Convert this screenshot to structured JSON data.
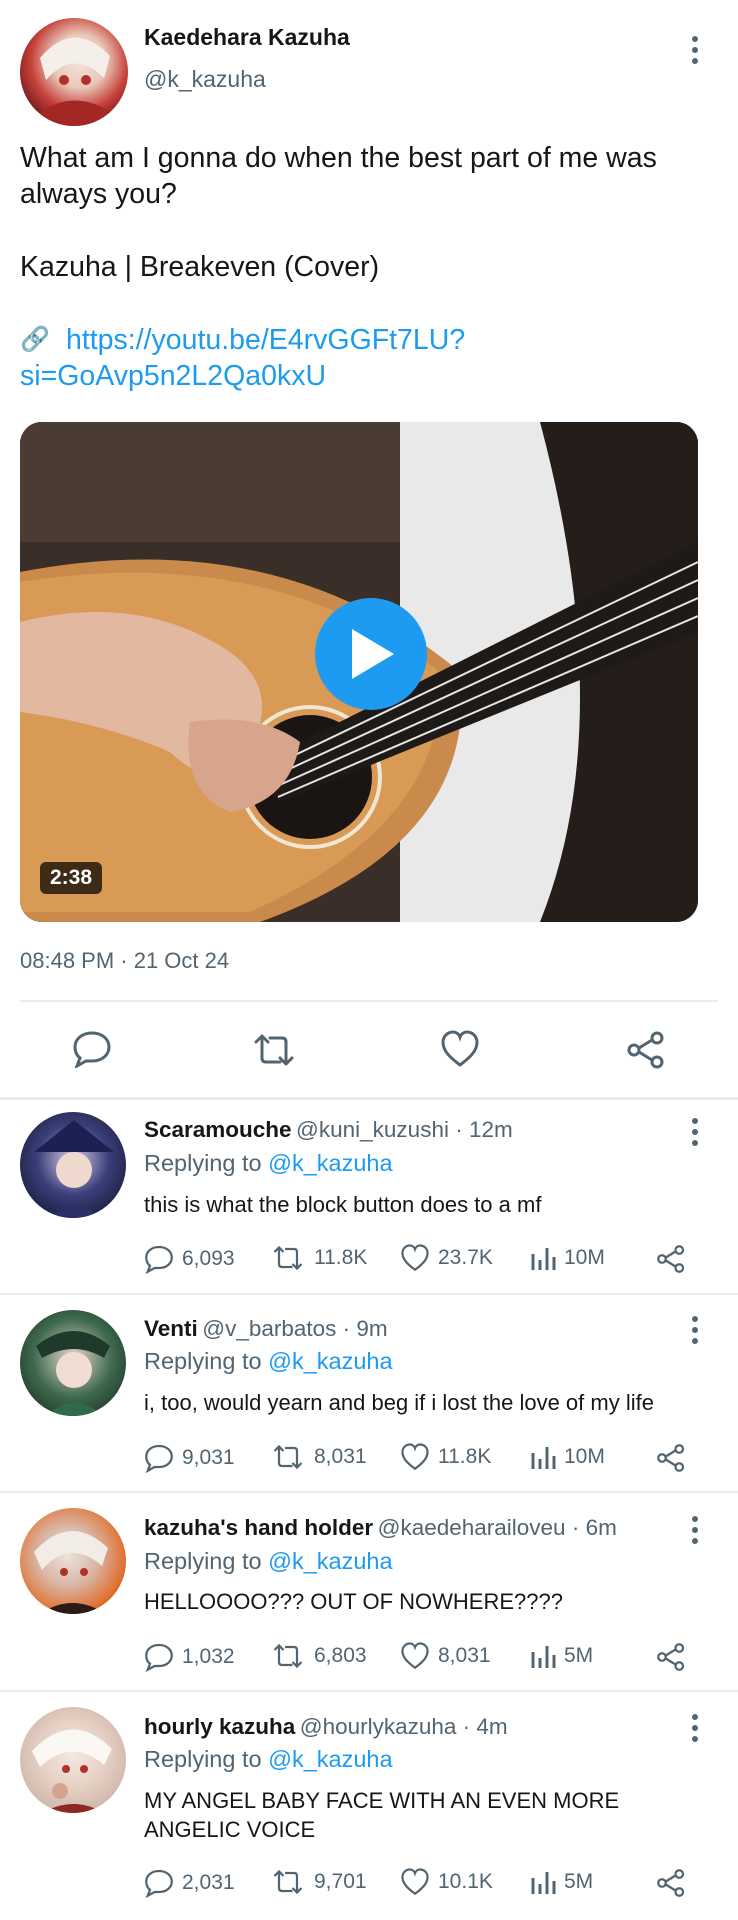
{
  "post": {
    "author_name": "Kaedehara Kazuha",
    "author_handle": "@k_kazuha",
    "text_line1": "What am I gonna do when the best part of me was",
    "text_line2": "always you?",
    "text_line3": "Kazuha | Breakeven (Cover)",
    "link_icon": "🔗",
    "link_line1": "https://youtu.be/E4rvGGFt7LU?",
    "link_line2": "si=GoAvp5n2L2Qa0kxU",
    "video_duration": "2:38",
    "timestamp": "08:48 PM · 21 Oct 24"
  },
  "replies": [
    {
      "name": "Scaramouche",
      "handle": "@kuni_kuzushi · 12m",
      "replying_label": "Replying to",
      "replying_to": "@k_kazuha",
      "text": "this is what the block button does to a mf",
      "text2": "",
      "comments": "6,093",
      "retweets": "11.8K",
      "likes": "23.7K",
      "views": "10M"
    },
    {
      "name": "Venti",
      "handle": "@v_barbatos · 9m",
      "replying_label": "Replying to",
      "replying_to": "@k_kazuha",
      "text": "i, too, would yearn and beg if i lost the love of my life",
      "text2": "",
      "comments": "9,031",
      "retweets": "8,031",
      "likes": "11.8K",
      "views": "10M"
    },
    {
      "name": "kazuha's hand holder",
      "handle": "@kaedeharailoveu · 6m",
      "replying_label": "Replying to",
      "replying_to": "@k_kazuha",
      "text": "HELLOOOO??? OUT OF NOWHERE????",
      "text2": "",
      "comments": "1,032",
      "retweets": "6,803",
      "likes": "8,031",
      "views": "5M"
    },
    {
      "name": "hourly kazuha",
      "handle": "@hourlykazuha · 4m",
      "replying_label": "Replying to",
      "replying_to": "@k_kazuha",
      "text": "MY ANGEL BABY FACE WITH AN EVEN MORE",
      "text2": "ANGELIC VOICE",
      "comments": "2,031",
      "retweets": "9,701",
      "likes": "10.1K",
      "views": "5M"
    }
  ],
  "colors": {
    "accent": "#1d9bf0",
    "text": "#14171a",
    "secondary": "#536471",
    "divider": "#e8ecef"
  }
}
